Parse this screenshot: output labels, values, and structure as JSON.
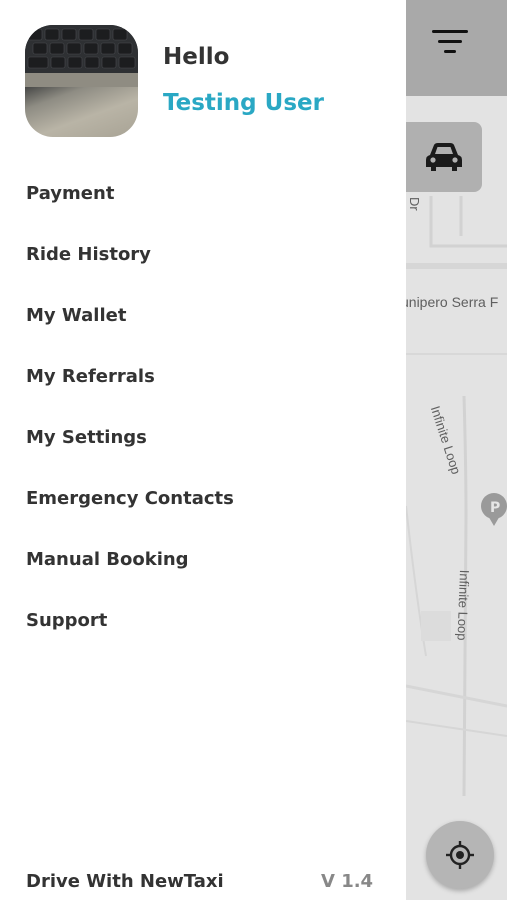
{
  "drawer": {
    "greeting": "Hello",
    "user_name": "Testing User",
    "menu": [
      {
        "label": "Payment",
        "name": "menu-item-payment"
      },
      {
        "label": "Ride History",
        "name": "menu-item-ride-history"
      },
      {
        "label": "My Wallet",
        "name": "menu-item-my-wallet"
      },
      {
        "label": "My Referrals",
        "name": "menu-item-my-referrals"
      },
      {
        "label": "My Settings",
        "name": "menu-item-my-settings"
      },
      {
        "label": "Emergency Contacts",
        "name": "menu-item-emergency-contacts"
      },
      {
        "label": "Manual Booking",
        "name": "menu-item-manual-booking"
      },
      {
        "label": "Support",
        "name": "menu-item-support"
      }
    ],
    "footer": {
      "drive_label": "Drive With NewTaxi",
      "version": "V 1.4"
    }
  },
  "map": {
    "street_labels": [
      "Dr",
      "unipero Serra F",
      "Infinite Loop",
      "Infinite Loop"
    ],
    "poi_icon": "parking-pin-icon"
  },
  "icons": {
    "filter": "filter-icon",
    "car": "car-icon",
    "locate": "my-location-icon"
  },
  "colors": {
    "accent": "#2aa8c4",
    "text_primary": "#333333",
    "text_muted": "#888888"
  }
}
